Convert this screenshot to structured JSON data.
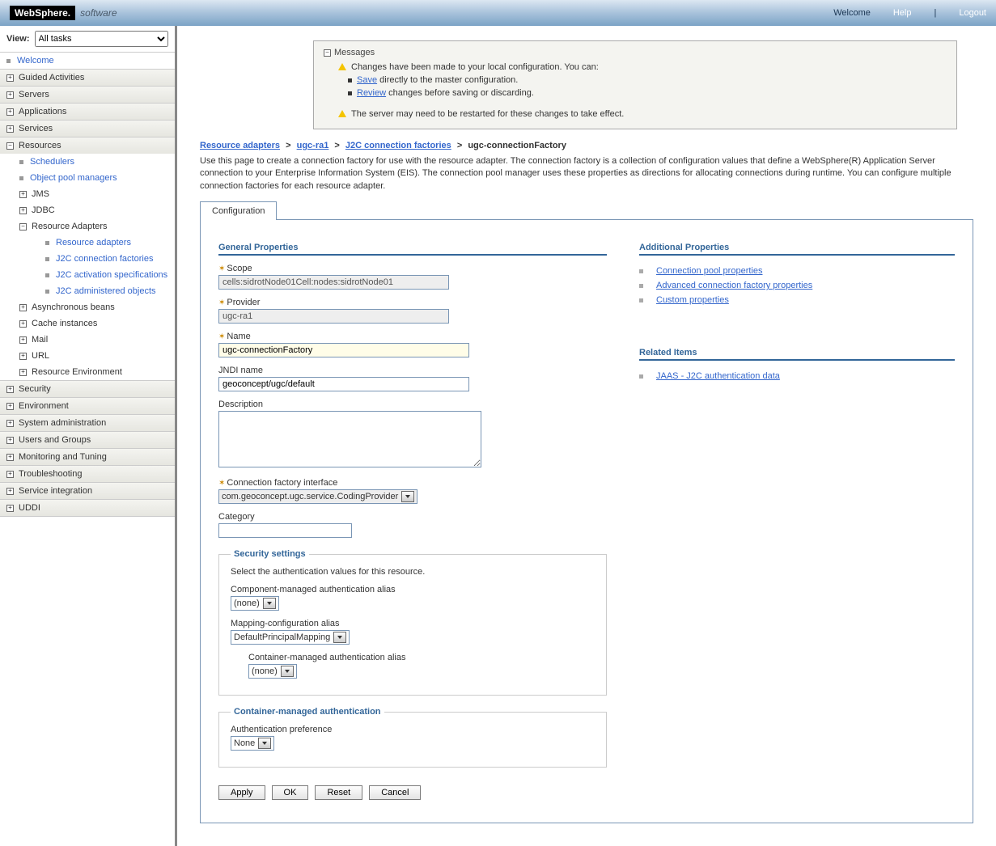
{
  "topbar": {
    "logo": "WebSphere.",
    "software": "software",
    "welcome": "Welcome",
    "help": "Help",
    "logout": "Logout"
  },
  "sidebar": {
    "view_label": "View:",
    "view_value": "All tasks",
    "welcome": "Welcome",
    "items": [
      {
        "label": "Guided Activities",
        "exp": "+"
      },
      {
        "label": "Servers",
        "exp": "+"
      },
      {
        "label": "Applications",
        "exp": "+"
      },
      {
        "label": "Services",
        "exp": "+"
      }
    ],
    "resources": {
      "label": "Resources",
      "exp": "−",
      "children": [
        {
          "label": "Schedulers",
          "link": true
        },
        {
          "label": "Object pool managers",
          "link": true
        },
        {
          "label": "JMS",
          "exp": "+"
        },
        {
          "label": "JDBC",
          "exp": "+"
        },
        {
          "label": "Resource Adapters",
          "exp": "−",
          "children": [
            {
              "label": "Resource adapters"
            },
            {
              "label": "J2C connection factories"
            },
            {
              "label": "J2C activation specifications"
            },
            {
              "label": "J2C administered objects"
            }
          ]
        },
        {
          "label": "Asynchronous beans",
          "exp": "+"
        },
        {
          "label": "Cache instances",
          "exp": "+"
        },
        {
          "label": "Mail",
          "exp": "+"
        },
        {
          "label": "URL",
          "exp": "+"
        },
        {
          "label": "Resource Environment",
          "exp": "+"
        }
      ]
    },
    "tail": [
      {
        "label": "Security",
        "exp": "+"
      },
      {
        "label": "Environment",
        "exp": "+"
      },
      {
        "label": "System administration",
        "exp": "+"
      },
      {
        "label": "Users and Groups",
        "exp": "+"
      },
      {
        "label": "Monitoring and Tuning",
        "exp": "+"
      },
      {
        "label": "Troubleshooting",
        "exp": "+"
      },
      {
        "label": "Service integration",
        "exp": "+"
      },
      {
        "label": "UDDI",
        "exp": "+"
      }
    ]
  },
  "messages": {
    "title": "Messages",
    "line1": "Changes have been made to your local configuration. You can:",
    "save": "Save",
    "save_tail": " directly to the master configuration.",
    "review": "Review",
    "review_tail": " changes before saving or discarding.",
    "restart": "The server may need to be restarted for these changes to take effect."
  },
  "breadcrumb": {
    "a": "Resource adapters",
    "b": "ugc-ra1",
    "c": "J2C connection factories",
    "d": "ugc-connectionFactory",
    "sep": ">"
  },
  "page_desc": "Use this page to create a connection factory for use with the resource adapter. The connection factory is a collection of configuration values that define a WebSphere(R) Application Server connection to your Enterprise Information System (EIS). The connection pool manager uses these properties as directions for allocating connections during runtime. You can configure multiple connection factories for each resource adapter.",
  "tab": "Configuration",
  "general": {
    "title": "General Properties",
    "scope_l": "Scope",
    "scope_v": "cells:sidrotNode01Cell:nodes:sidrotNode01",
    "provider_l": "Provider",
    "provider_v": "ugc-ra1",
    "name_l": "Name",
    "name_v": "ugc-connectionFactory",
    "jndi_l": "JNDI name",
    "jndi_v": "geoconcept/ugc/default",
    "desc_l": "Description",
    "desc_v": "",
    "cfi_l": "Connection factory interface",
    "cfi_v": "com.geoconcept.ugc.service.CodingProvider",
    "cat_l": "Category",
    "cat_v": ""
  },
  "security": {
    "title": "Security settings",
    "hint": "Select the authentication values for this resource.",
    "comp_l": "Component-managed authentication alias",
    "comp_v": "(none)",
    "map_l": "Mapping-configuration alias",
    "map_v": "DefaultPrincipalMapping",
    "cont_l": "Container-managed authentication alias",
    "cont_v": "(none)"
  },
  "cma": {
    "title": "Container-managed authentication",
    "pref_l": "Authentication preference",
    "pref_v": "None"
  },
  "buttons": {
    "apply": "Apply",
    "ok": "OK",
    "reset": "Reset",
    "cancel": "Cancel"
  },
  "additional": {
    "title": "Additional Properties",
    "links": [
      "Connection pool properties",
      "Advanced connection factory properties",
      "Custom properties"
    ]
  },
  "related": {
    "title": "Related Items",
    "links": [
      "JAAS - J2C authentication data"
    ]
  }
}
